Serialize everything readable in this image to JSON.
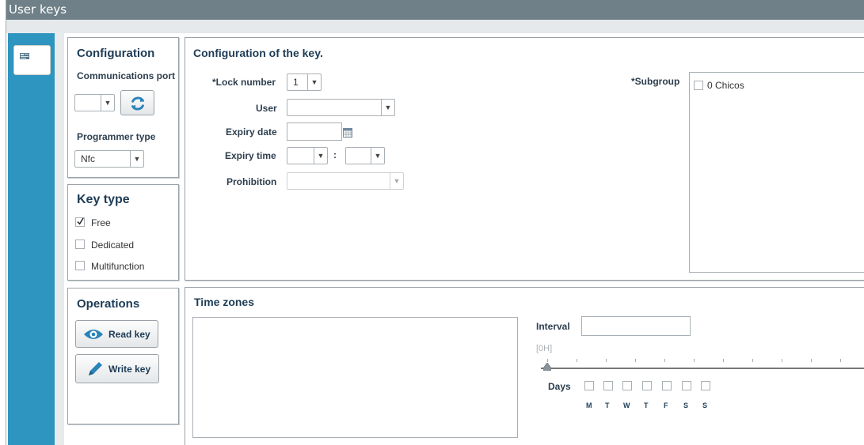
{
  "window": {
    "title": "User keys"
  },
  "config": {
    "title": "Configuration",
    "port_label": "Communications port",
    "programmer_label": "Programmer type",
    "programmer_value": "Nfc"
  },
  "keytype": {
    "title": "Key type",
    "options": [
      {
        "label": "Free",
        "checked": true
      },
      {
        "label": "Dedicated",
        "checked": false
      },
      {
        "label": "Multifunction",
        "checked": false
      }
    ]
  },
  "operations": {
    "title": "Operations",
    "read_label": "Read key",
    "write_label": "Write key"
  },
  "keyconfig": {
    "title": "Configuration of the key.",
    "lock_label": "*Lock number",
    "lock_value": "1",
    "user_label": "User",
    "expiry_date_label": "Expiry date",
    "expiry_time_label": "Expiry time",
    "time_sep": ":",
    "prohibition_label": "Prohibition",
    "subgroup_label": "*Subgroup",
    "subgroups": [
      "0 Chicos"
    ]
  },
  "timezones": {
    "title": "Time zones",
    "interval_label": "Interval",
    "slider_value": "[0H]",
    "days_label": "Days",
    "days": [
      "M",
      "T",
      "W",
      "T",
      "F",
      "S",
      "S"
    ]
  }
}
